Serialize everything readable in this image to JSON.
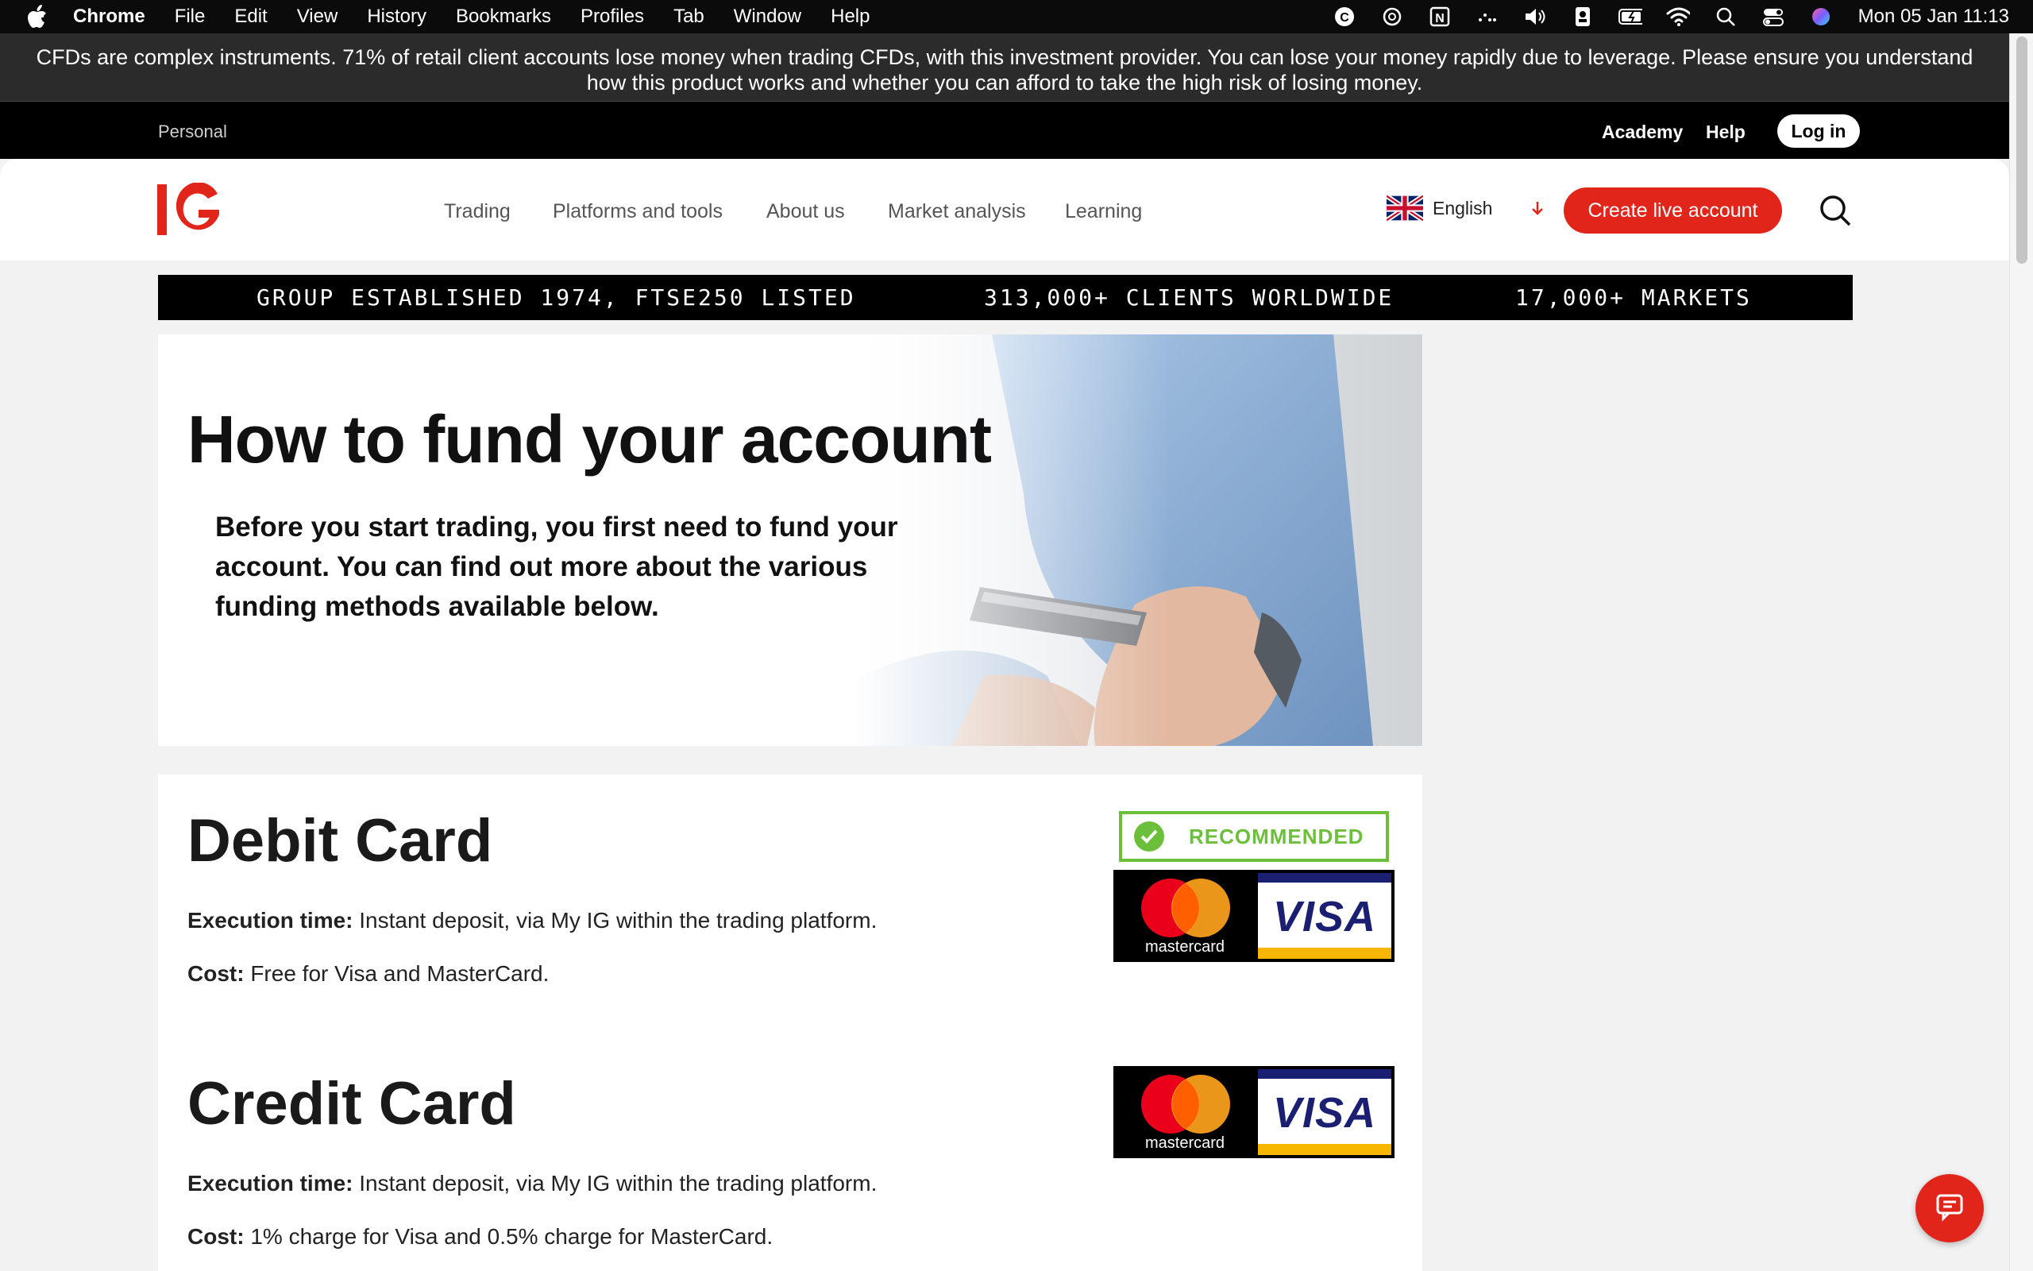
{
  "menubar": {
    "app": "Chrome",
    "items": [
      "File",
      "Edit",
      "View",
      "History",
      "Bookmarks",
      "Profiles",
      "Tab",
      "Window",
      "Help"
    ],
    "clock": "Mon 05 Jan  11:13"
  },
  "risk_warning": "CFDs are complex instruments. 71% of retail client accounts lose money when trading CFDs, with this investment provider. You can lose your money rapidly due to leverage. Please ensure you understand how this product works and whether you can afford to take the high risk of losing money.",
  "top_strip": {
    "segment": "Personal",
    "academy": "Academy",
    "help": "Help",
    "login": "Log in"
  },
  "header": {
    "logo": "IG",
    "nav": [
      "Trading",
      "Platforms and tools",
      "About us",
      "Market analysis",
      "Learning"
    ],
    "language": "English",
    "cta": "Create live account"
  },
  "stats": [
    "GROUP ESTABLISHED 1974, FTSE250 LISTED",
    "313,000+ CLIENTS WORLDWIDE",
    "17,000+ MARKETS"
  ],
  "hero": {
    "title": "How to fund your account",
    "subtitle": "Before you start trading, you first need to fund your account. You can find out more about the various funding methods available below."
  },
  "sections": [
    {
      "title": "Debit Card",
      "exec_label": "Execution time:",
      "exec_value": " Instant deposit, via My IG within the trading platform.",
      "cost_label": "Cost:",
      "cost_value": " Free for Visa and MasterCard.",
      "badge": "RECOMMENDED",
      "logos": {
        "mastercard": "mastercard",
        "visa": "VISA"
      }
    },
    {
      "title": "Credit Card",
      "exec_label": "Execution time:",
      "exec_value": " Instant deposit, via My IG within the trading platform.",
      "cost_label": "Cost:",
      "cost_value": " 1% charge for Visa and 0.5% charge for MasterCard.",
      "logos": {
        "mastercard": "mastercard",
        "visa": "VISA"
      }
    }
  ],
  "colors": {
    "brand_red": "#e1251b",
    "recommended_green": "#6cbf3b",
    "visa_blue": "#1a1f71",
    "visa_gold": "#f7b600"
  },
  "icons": [
    "apple-icon",
    "wifi-icon",
    "search-icon",
    "volume-icon",
    "battery-icon",
    "chat-icon",
    "uk-flag-icon",
    "arrow-down-icon",
    "check-icon"
  ]
}
